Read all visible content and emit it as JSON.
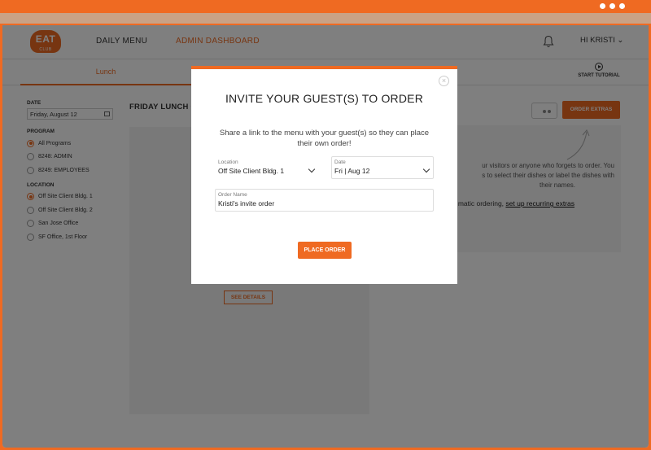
{
  "nav": {
    "logo_text": "EAT",
    "logo_subtext": "CLUB",
    "daily_menu": "DAILY MENU",
    "admin_dashboard": "ADMIN DASHBOARD",
    "user_label": "HI KRISTI"
  },
  "subnav": {
    "tab_lunch": "Lunch",
    "start_tutorial": "START TUTORIAL"
  },
  "sidebar": {
    "date_heading": "DATE",
    "date_value": "Friday, August 12",
    "program_heading": "PROGRAM",
    "programs": [
      "All Programs",
      "8248: ADMIN",
      "8249: EMPLOYEES"
    ],
    "location_heading": "LOCATION",
    "locations": [
      "Off Site Client Bldg. 1",
      "Off Site Client Bldg. 2",
      "San Jose Office",
      "SF Office, 1st Floor"
    ]
  },
  "main": {
    "title": "FRIDAY LUNCH OR",
    "see_details": "SEE DETAILS",
    "order_extras": "ORDER EXTRAS",
    "extras_line1": "ur visitors or anyone who forgets to order. You",
    "extras_line2": "s to select their dishes or label the dishes with",
    "extras_line3": "their names.",
    "recurring_prefix": "matic ordering,",
    "recurring_link": "set up recurring extras"
  },
  "modal": {
    "title": "INVITE YOUR GUEST(S) TO ORDER",
    "description": "Share a link to the menu with your guest(s) so they can place their own order!",
    "location_label": "Location",
    "location_value": "Off Site Client Bldg. 1",
    "date_label": "Date",
    "date_value": "Fri | Aug 12",
    "order_name_label": "Order Name",
    "order_name_value": "Kristi's invite order",
    "place_order": "PLACE ORDER",
    "close_glyph": "×"
  },
  "colors": {
    "accent": "#ef6a22",
    "frame_strip": "#c9a286"
  }
}
